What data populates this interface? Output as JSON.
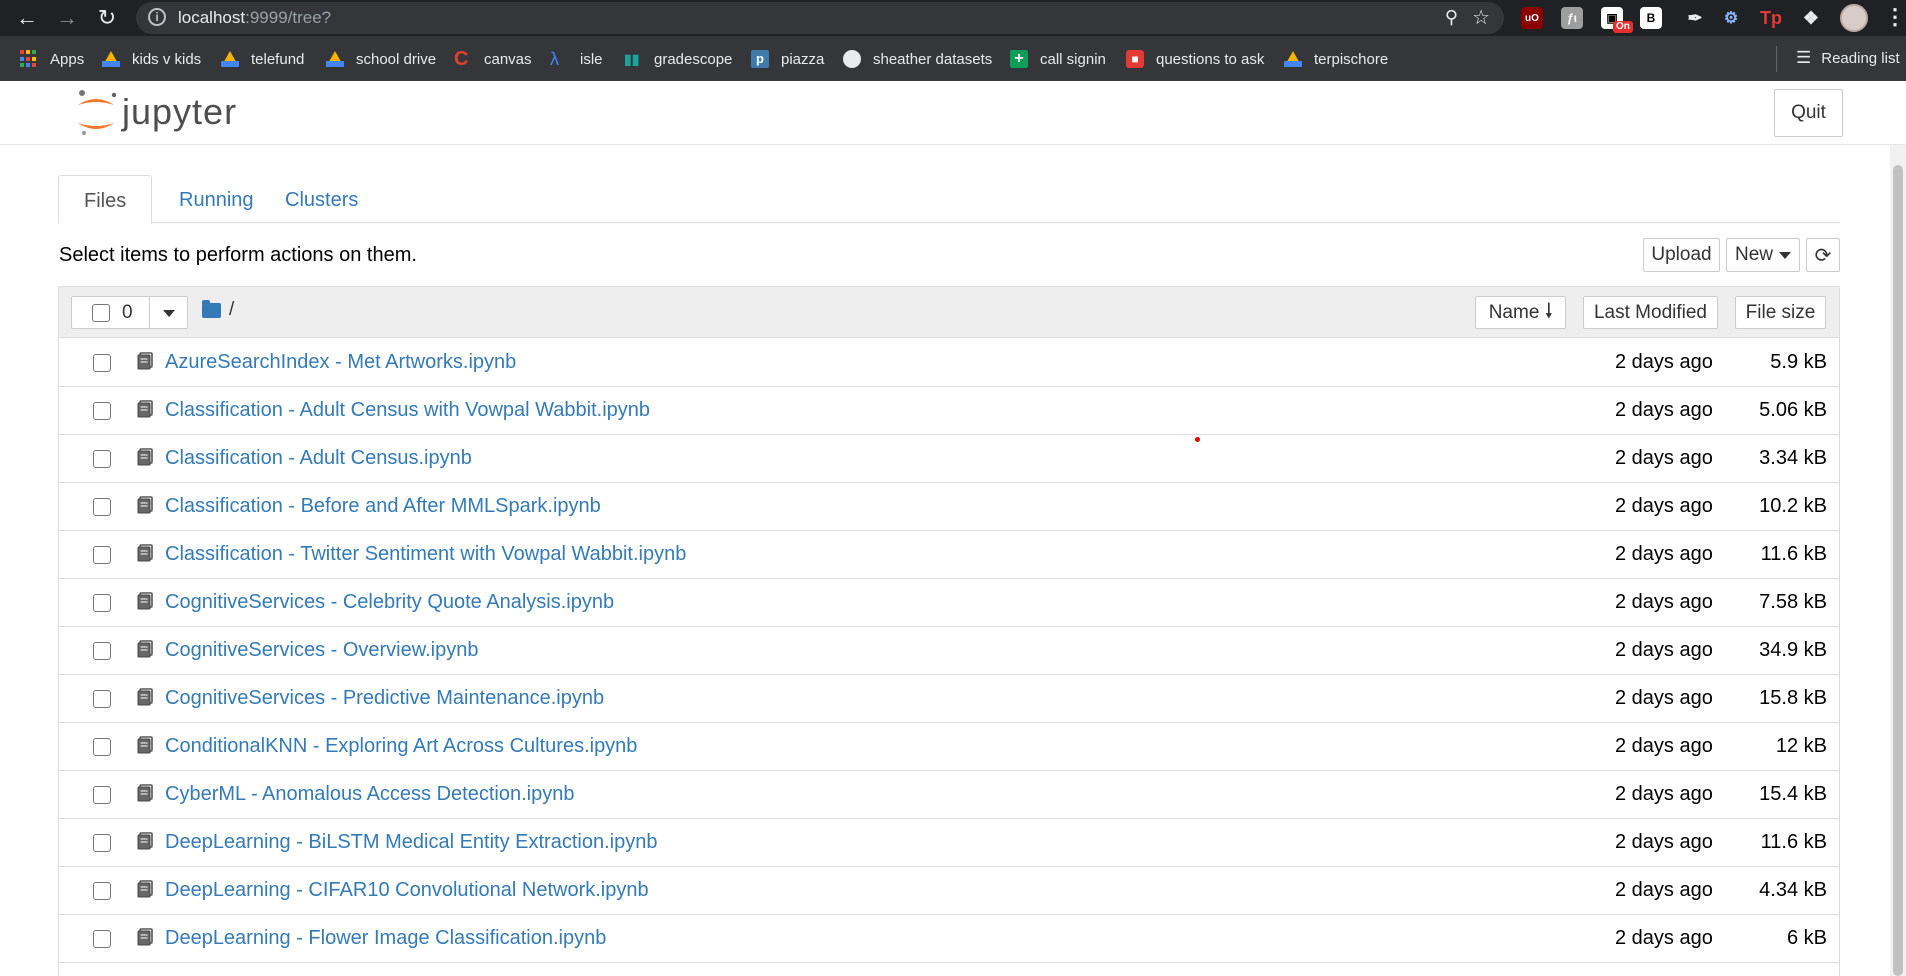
{
  "browser": {
    "url_host": "localhost",
    "url_path": ":9999/tree?",
    "ext_badge": "On",
    "ext_letters": {
      "ublock": "uO",
      "fh": "ƒι",
      "book": "B",
      "tp": "Tp"
    },
    "bookmarks": [
      {
        "label": "Apps",
        "icon": "apps-grid-icon"
      },
      {
        "label": "kids v kids",
        "icon": "google-drive-icon"
      },
      {
        "label": "telefund",
        "icon": "google-drive-icon"
      },
      {
        "label": "school drive",
        "icon": "google-drive-icon"
      },
      {
        "label": "canvas",
        "icon": "canvas-icon"
      },
      {
        "label": "isle",
        "icon": "isle-icon"
      },
      {
        "label": "gradescope",
        "icon": "gradescope-icon"
      },
      {
        "label": "piazza",
        "icon": "piazza-icon"
      },
      {
        "label": "sheather datasets",
        "icon": "globe-icon"
      },
      {
        "label": "call signin",
        "icon": "google-sheets-icon"
      },
      {
        "label": "questions to ask",
        "icon": "red-form-icon"
      },
      {
        "label": "terpischore",
        "icon": "google-drive-icon"
      }
    ],
    "reading_list": "Reading list"
  },
  "header": {
    "logo_text": "jupyter",
    "quit_label": "Quit"
  },
  "tabs": [
    {
      "label": "Files",
      "active": true
    },
    {
      "label": "Running",
      "active": false
    },
    {
      "label": "Clusters",
      "active": false
    }
  ],
  "toolbar": {
    "notice": "Select items to perform actions on them.",
    "upload_label": "Upload",
    "new_label": "New"
  },
  "list_header": {
    "selected_count": "0",
    "breadcrumb": "/",
    "sort_name": "Name",
    "sort_modified": "Last Modified",
    "sort_size": "File size"
  },
  "files": [
    {
      "name": "AzureSearchIndex - Met Artworks.ipynb",
      "modified": "2 days ago",
      "size": "5.9 kB"
    },
    {
      "name": "Classification - Adult Census with Vowpal Wabbit.ipynb",
      "modified": "2 days ago",
      "size": "5.06 kB"
    },
    {
      "name": "Classification - Adult Census.ipynb",
      "modified": "2 days ago",
      "size": "3.34 kB"
    },
    {
      "name": "Classification - Before and After MMLSpark.ipynb",
      "modified": "2 days ago",
      "size": "10.2 kB"
    },
    {
      "name": "Classification - Twitter Sentiment with Vowpal Wabbit.ipynb",
      "modified": "2 days ago",
      "size": "11.6 kB"
    },
    {
      "name": "CognitiveServices - Celebrity Quote Analysis.ipynb",
      "modified": "2 days ago",
      "size": "7.58 kB"
    },
    {
      "name": "CognitiveServices - Overview.ipynb",
      "modified": "2 days ago",
      "size": "34.9 kB"
    },
    {
      "name": "CognitiveServices - Predictive Maintenance.ipynb",
      "modified": "2 days ago",
      "size": "15.8 kB"
    },
    {
      "name": "ConditionalKNN - Exploring Art Across Cultures.ipynb",
      "modified": "2 days ago",
      "size": "12 kB"
    },
    {
      "name": "CyberML - Anomalous Access Detection.ipynb",
      "modified": "2 days ago",
      "size": "15.4 kB"
    },
    {
      "name": "DeepLearning - BiLSTM Medical Entity Extraction.ipynb",
      "modified": "2 days ago",
      "size": "11.6 kB"
    },
    {
      "name": "DeepLearning - CIFAR10 Convolutional Network.ipynb",
      "modified": "2 days ago",
      "size": "4.34 kB"
    },
    {
      "name": "DeepLearning - Flower Image Classification.ipynb",
      "modified": "2 days ago",
      "size": "6 kB"
    }
  ],
  "colors": {
    "link": "#337ab7",
    "chrome_dark": "#202124",
    "bookmarks_bar": "#35363a",
    "jupyter_orange": "#f37726"
  }
}
